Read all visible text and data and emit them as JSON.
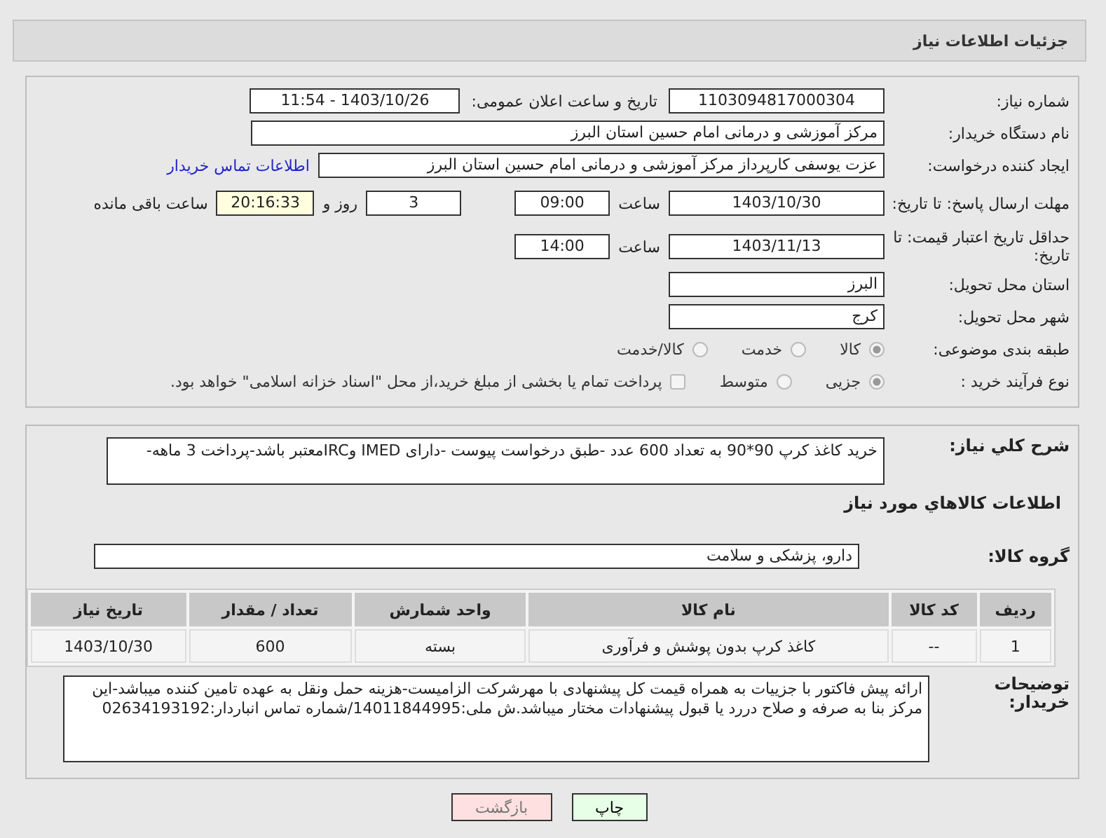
{
  "header": {
    "title": "جزئیات اطلاعات نیاز"
  },
  "need_number": {
    "label": "شماره نیاز:",
    "value": "1103094817000304"
  },
  "announce": {
    "label": "تاریخ و ساعت اعلان عمومی:",
    "value": "1403/10/26 - 11:54"
  },
  "buyer_org": {
    "label": "نام دستگاه خریدار:",
    "value": "مرکز آموزشی و درمانی امام حسین استان البرز"
  },
  "requester": {
    "label": "ایجاد کننده درخواست:",
    "value": "عزت یوسفی کارپرداز مرکز آموزشی و درمانی امام حسین استان البرز",
    "link": "اطلاعات تماس خریدار"
  },
  "deadline": {
    "label": "مهلت ارسال پاسخ: تا تاریخ:",
    "date": "1403/10/30",
    "time_label": "ساعت",
    "time": "09:00",
    "days": "3",
    "days_label": "روز و",
    "remaining": "20:16:33",
    "remaining_label": "ساعت باقی مانده"
  },
  "validity": {
    "label": "حداقل تاریخ اعتبار قیمت: تا تاریخ:",
    "date": "1403/11/13",
    "time_label": "ساعت",
    "time": "14:00"
  },
  "province": {
    "label": "استان محل تحویل:",
    "value": "البرز"
  },
  "city": {
    "label": "شهر محل تحویل:",
    "value": "کرج"
  },
  "category": {
    "label": "طبقه بندی موضوعی:",
    "options": [
      {
        "label": "کالا",
        "selected": true
      },
      {
        "label": "خدمت",
        "selected": false
      },
      {
        "label": "کالا/خدمت",
        "selected": false
      }
    ]
  },
  "process": {
    "label": "نوع فرآیند خرید :",
    "options": [
      {
        "label": "جزیی",
        "selected": true
      },
      {
        "label": "متوسط",
        "selected": false
      }
    ],
    "payment": {
      "label": "پرداخت تمام یا بخشی از مبلغ خرید،از محل \"اسناد خزانه اسلامی\" خواهد بود.",
      "checked": false
    }
  },
  "description": {
    "label": "شرح کلي نياز:",
    "value": "خرید کاغذ کرپ 90*90 به تعداد 600 عدد -طبق درخواست پیوست -دارای IMED وIRCمعتبر باشد-پرداخت 3 ماهه-"
  },
  "goods_title": "اطلاعات کالاهاي مورد نياز",
  "goods_group": {
    "label": "گروه کالا:",
    "value": "دارو، پزشکی و سلامت"
  },
  "table": {
    "columns": [
      "ردیف",
      "کد کالا",
      "نام کالا",
      "واحد شمارش",
      "تعداد / مقدار",
      "تاریخ نیاز"
    ],
    "rows": [
      [
        "1",
        "--",
        "کاغذ کرپ بدون پوشش و فرآوری",
        "بسته",
        "600",
        "1403/10/30"
      ]
    ]
  },
  "buyer_notes": {
    "label": "توضیحات خریدار:",
    "value": "ارائه پیش فاکتور با جزییات به همراه قیمت کل پیشنهادی با مهرشرکت الزامیست-هزینه حمل ونقل به عهده تامین کننده میباشد-این مرکز بنا به صرفه و صلاح دررد یا قبول پیشنهادات مختار میباشد.ش ملی:14011844995/شماره تماس انباردار:02634193192"
  },
  "buttons": [
    {
      "label": "چاپ",
      "kind": "print"
    },
    {
      "label": "بازگشت",
      "kind": "back"
    }
  ]
}
